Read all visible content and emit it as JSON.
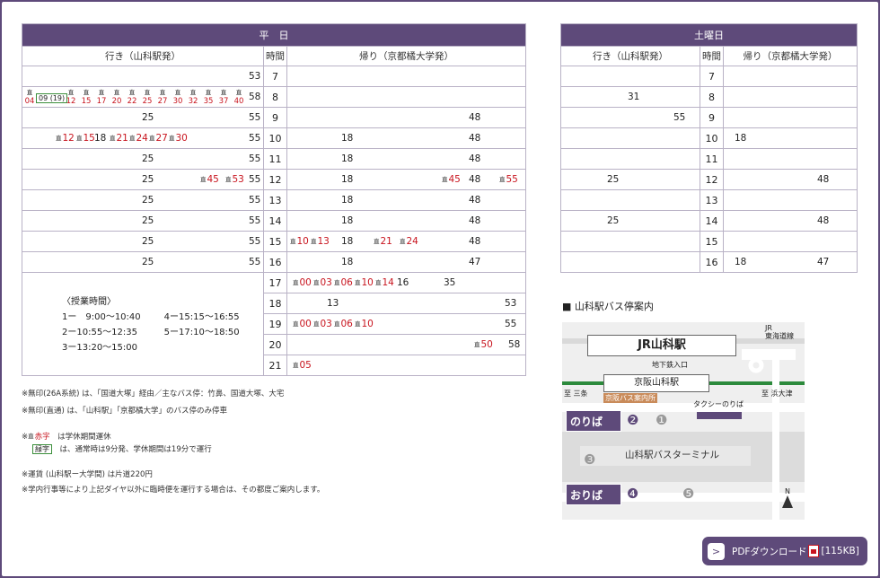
{
  "weekday": {
    "caption": "平　日",
    "col_go": "行き（山科駅発）",
    "col_hour": "時間",
    "col_back": "帰り（京都橘大学発）",
    "hours": [
      "7",
      "8",
      "9",
      "10",
      "11",
      "12",
      "13",
      "14",
      "15",
      "16",
      "17",
      "18",
      "19",
      "20",
      "21"
    ],
    "go": {
      "7": {
        "n53": "53"
      },
      "8": {
        "e1": "04",
        "e2": "12",
        "e3": "15",
        "e4": "17",
        "e5": "20",
        "e6": "22",
        "e7": "25",
        "e8": "27",
        "e9": "30",
        "e10": "32",
        "e11": "35",
        "e12": "37",
        "e13": "40",
        "green": "09 (19)",
        "n58": "58",
        "tag": "直"
      },
      "9": {
        "a": "25",
        "b": "55"
      },
      "10": {
        "r1": "12",
        "r2": "15",
        "n18": "18",
        "r3": "21",
        "r4": "24",
        "r5": "27",
        "r6": "30",
        "b": "55"
      },
      "11": {
        "a": "25",
        "b": "55"
      },
      "12": {
        "a": "25",
        "r1": "45",
        "r2": "53",
        "b": "55"
      },
      "13": {
        "a": "25",
        "b": "55"
      },
      "14": {
        "a": "25",
        "b": "55"
      },
      "15": {
        "a": "25",
        "b": "55"
      },
      "16": {
        "a": "25",
        "b": "55"
      }
    },
    "back": {
      "10": {
        "a": "18",
        "b": "48"
      },
      "9": {
        "b": "48"
      },
      "11": {
        "a": "18",
        "b": "48"
      },
      "12": {
        "a": "18",
        "r1": "45",
        "b": "48",
        "r2": "55"
      },
      "13": {
        "a": "18",
        "b": "48"
      },
      "14": {
        "a": "18",
        "b": "48"
      },
      "15": {
        "r1": "10",
        "r2": "13",
        "a": "18",
        "r3": "21",
        "r4": "24",
        "b": "48"
      },
      "16": {
        "a": "18",
        "b": "47"
      },
      "17": {
        "r1": "00",
        "r2": "03",
        "r3": "06",
        "r4": "10",
        "r5": "14",
        "a": "16",
        "b": "35"
      },
      "18": {
        "a": "13",
        "b": "53"
      },
      "19": {
        "r1": "00",
        "r2": "03",
        "r3": "06",
        "r4": "10",
        "b": "55"
      },
      "20": {
        "r1": "50",
        "b": "58"
      },
      "21": {
        "r1": "05"
      }
    },
    "tag": "直",
    "classes": {
      "title": "〈授業時間〉",
      "p1": "1ー　9:00〜10:40",
      "p2": "2ー10:55〜12:35",
      "p3": "3ー13:20〜15:00",
      "p4": "4ー15:15〜16:55",
      "p5": "5ー17:10〜18:50"
    }
  },
  "saturday": {
    "caption": "土曜日",
    "col_go": "行き（山科駅発）",
    "col_hour": "時間",
    "col_back": "帰り（京都橘大学発）",
    "hours": [
      "7",
      "8",
      "9",
      "10",
      "11",
      "12",
      "13",
      "14",
      "15",
      "16"
    ],
    "go": {
      "8": "31",
      "9": "55",
      "12": "25",
      "14": "25"
    },
    "back": {
      "10": "18",
      "12": "48",
      "14": "48",
      "16a": "18",
      "16b": "47"
    }
  },
  "notes": {
    "n1": "※無印(26A系統) は、「国道大塚」経由／主なバス停：竹鼻、国道大塚、大宅",
    "n2": "※無印(直通) は、「山科駅」「京都橘大学」のバス停のみ停車",
    "n3_pre": "※",
    "n3_red": "赤字",
    "n3_post": "は学休期間運休",
    "n4_box": "緑字",
    "n4_post": "は、通常時は9分発、学休期間は19分で運行",
    "n5": "※運賃 (山科駅ー大学間) は片道220円",
    "n6": "※学内行事等により上記ダイヤ以外に臨時便を運行する場合は、その都度ご案内します。"
  },
  "map": {
    "title": "■ 山科駅バス停案内",
    "jr_station": "JR山科駅",
    "jr_line": "JR\n東海道線",
    "subway": "地下鉄入口",
    "keihan": "京阪山科駅",
    "info": "京阪バス案内所",
    "taxi": "タクシーのりば",
    "sanjo": "至 三条",
    "hamaotsu": "至 浜大津",
    "noriba": "のりば",
    "oriba": "おりば",
    "terminal": "山科駅バスターミナル",
    "n1": "❶",
    "n2": "❷",
    "n3": "❸",
    "n4": "❹",
    "n5": "❺",
    "north": "N"
  },
  "download": {
    "label": "PDFダウンロード",
    "size": "[115KB]"
  }
}
